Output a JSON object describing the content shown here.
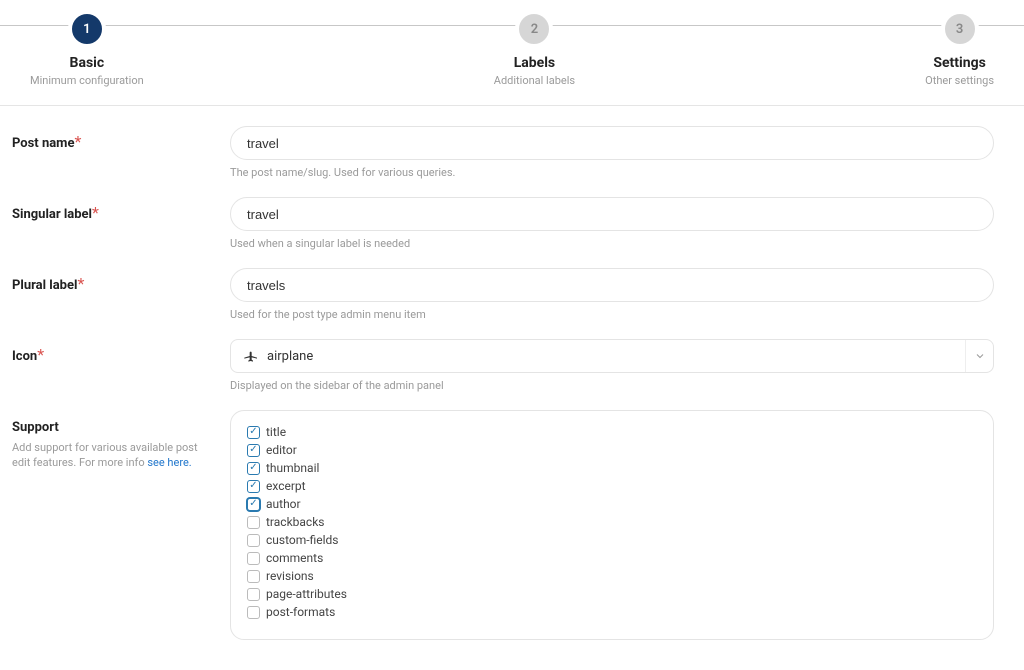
{
  "stepper": {
    "steps": [
      {
        "num": "1",
        "title": "Basic",
        "sub": "Minimum configuration",
        "active": true
      },
      {
        "num": "2",
        "title": "Labels",
        "sub": "Additional labels",
        "active": false
      },
      {
        "num": "3",
        "title": "Settings",
        "sub": "Other settings",
        "active": false
      }
    ]
  },
  "fields": {
    "post_name": {
      "label": "Post name",
      "value": "travel",
      "help": "The post name/slug. Used for various queries."
    },
    "singular": {
      "label": "Singular label",
      "value": "travel",
      "help": "Used when a singular label is needed"
    },
    "plural": {
      "label": "Plural label",
      "value": "travels",
      "help": "Used for the post type admin menu item"
    },
    "icon": {
      "label": "Icon",
      "value": "airplane",
      "icon_name": "airplane-icon",
      "help": "Displayed on the sidebar of the admin panel"
    }
  },
  "support": {
    "label": "Support",
    "help_prefix": "Add support for various available post edit features. For more info ",
    "help_link": "see here.",
    "options": [
      {
        "label": "title",
        "checked": true,
        "focused": false
      },
      {
        "label": "editor",
        "checked": true,
        "focused": false
      },
      {
        "label": "thumbnail",
        "checked": true,
        "focused": false
      },
      {
        "label": "excerpt",
        "checked": true,
        "focused": false
      },
      {
        "label": "author",
        "checked": true,
        "focused": true
      },
      {
        "label": "trackbacks",
        "checked": false,
        "focused": false
      },
      {
        "label": "custom-fields",
        "checked": false,
        "focused": false
      },
      {
        "label": "comments",
        "checked": false,
        "focused": false
      },
      {
        "label": "revisions",
        "checked": false,
        "focused": false
      },
      {
        "label": "page-attributes",
        "checked": false,
        "focused": false
      },
      {
        "label": "post-formats",
        "checked": false,
        "focused": false
      }
    ]
  }
}
